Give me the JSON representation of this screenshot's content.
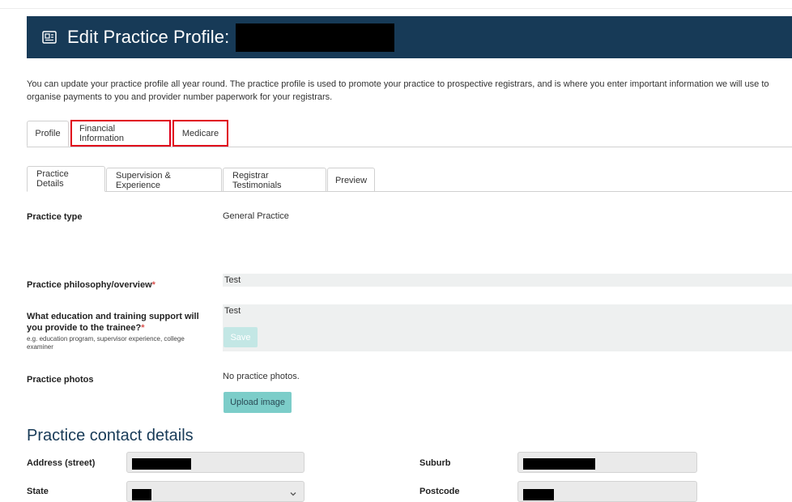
{
  "header": {
    "title": "Edit Practice Profile:",
    "icon": "profile-card-icon"
  },
  "intro": "You can update your practice profile all year round. The practice profile is used to promote your practice to prospective registrars, and is where you enter important information we will use to organise payments to you and provider number paperwork for your registrars.",
  "main_tabs": [
    {
      "label": "Profile"
    },
    {
      "label": "Financial Information"
    },
    {
      "label": "Medicare"
    }
  ],
  "sub_tabs": [
    {
      "label": "Practice Details"
    },
    {
      "label": "Supervision & Experience"
    },
    {
      "label": "Registrar Testimonials"
    },
    {
      "label": "Preview"
    }
  ],
  "fields": {
    "practice_type": {
      "label": "Practice type",
      "value": "General Practice"
    },
    "philosophy": {
      "label": "Practice philosophy/overview",
      "required": "*",
      "value": "Test"
    },
    "education": {
      "label": "What education and training support will you provide to the trainee?",
      "required": "*",
      "help": "e.g. education program, supervisor experience, college examiner",
      "value": "Test",
      "save_label": "Save"
    },
    "photos": {
      "label": "Practice photos",
      "value": "No practice photos.",
      "upload_label": "Upload image"
    }
  },
  "contact": {
    "title": "Practice contact details",
    "address_label": "Address (street)",
    "suburb_label": "Suburb",
    "state_label": "State",
    "postcode_label": "Postcode"
  },
  "colors": {
    "header_bg": "#173a57",
    "button_bg": "#7ccdc9",
    "highlight": "#e0001b",
    "required": "#d9534f"
  }
}
